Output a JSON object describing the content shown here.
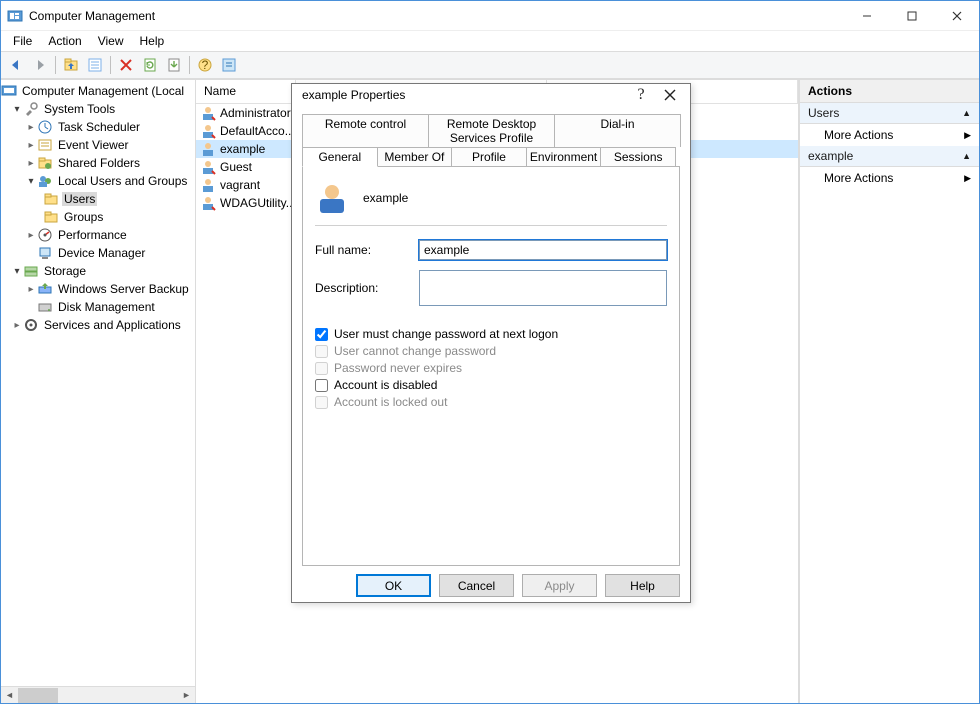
{
  "window": {
    "title": "Computer Management"
  },
  "menu": {
    "file": "File",
    "action": "Action",
    "view": "View",
    "help": "Help"
  },
  "toolbar_icons": [
    "back",
    "forward",
    "up",
    "props",
    "delete",
    "refresh",
    "export",
    "help-contents",
    "help"
  ],
  "tree": {
    "root": "Computer Management (Local",
    "system_tools": "System Tools",
    "task_scheduler": "Task Scheduler",
    "event_viewer": "Event Viewer",
    "shared_folders": "Shared Folders",
    "local_users": "Local Users and Groups",
    "users": "Users",
    "groups": "Groups",
    "performance": "Performance",
    "device_manager": "Device Manager",
    "storage": "Storage",
    "win_backup": "Windows Server Backup",
    "disk_mgmt": "Disk Management",
    "services": "Services and Applications"
  },
  "list": {
    "col_name": "Name",
    "items": [
      {
        "name": "Administrator"
      },
      {
        "name": "DefaultAcco..."
      },
      {
        "name": "example"
      },
      {
        "name": "Guest"
      },
      {
        "name": "vagrant"
      },
      {
        "name": "WDAGUtility..."
      }
    ]
  },
  "actions": {
    "title": "Actions",
    "section1": "Users",
    "more1": "More Actions",
    "section2": "example",
    "more2": "More Actions"
  },
  "dialog": {
    "title": "example Properties",
    "tabs_row1": {
      "remote_control": "Remote control",
      "rds_profile": "Remote Desktop Services Profile",
      "dialin": "Dial-in"
    },
    "tabs_row2": {
      "general": "General",
      "memberof": "Member Of",
      "profile": "Profile",
      "environment": "Environment",
      "sessions": "Sessions"
    },
    "username": "example",
    "fullname_label": "Full name:",
    "fullname_value": "example",
    "description_label": "Description:",
    "description_value": "",
    "chk_must_change": "User must change password at next logon",
    "chk_cannot_change": "User cannot change password",
    "chk_never_expires": "Password never expires",
    "chk_disabled": "Account is disabled",
    "chk_locked": "Account is locked out",
    "buttons": {
      "ok": "OK",
      "cancel": "Cancel",
      "apply": "Apply",
      "help": "Help"
    }
  }
}
